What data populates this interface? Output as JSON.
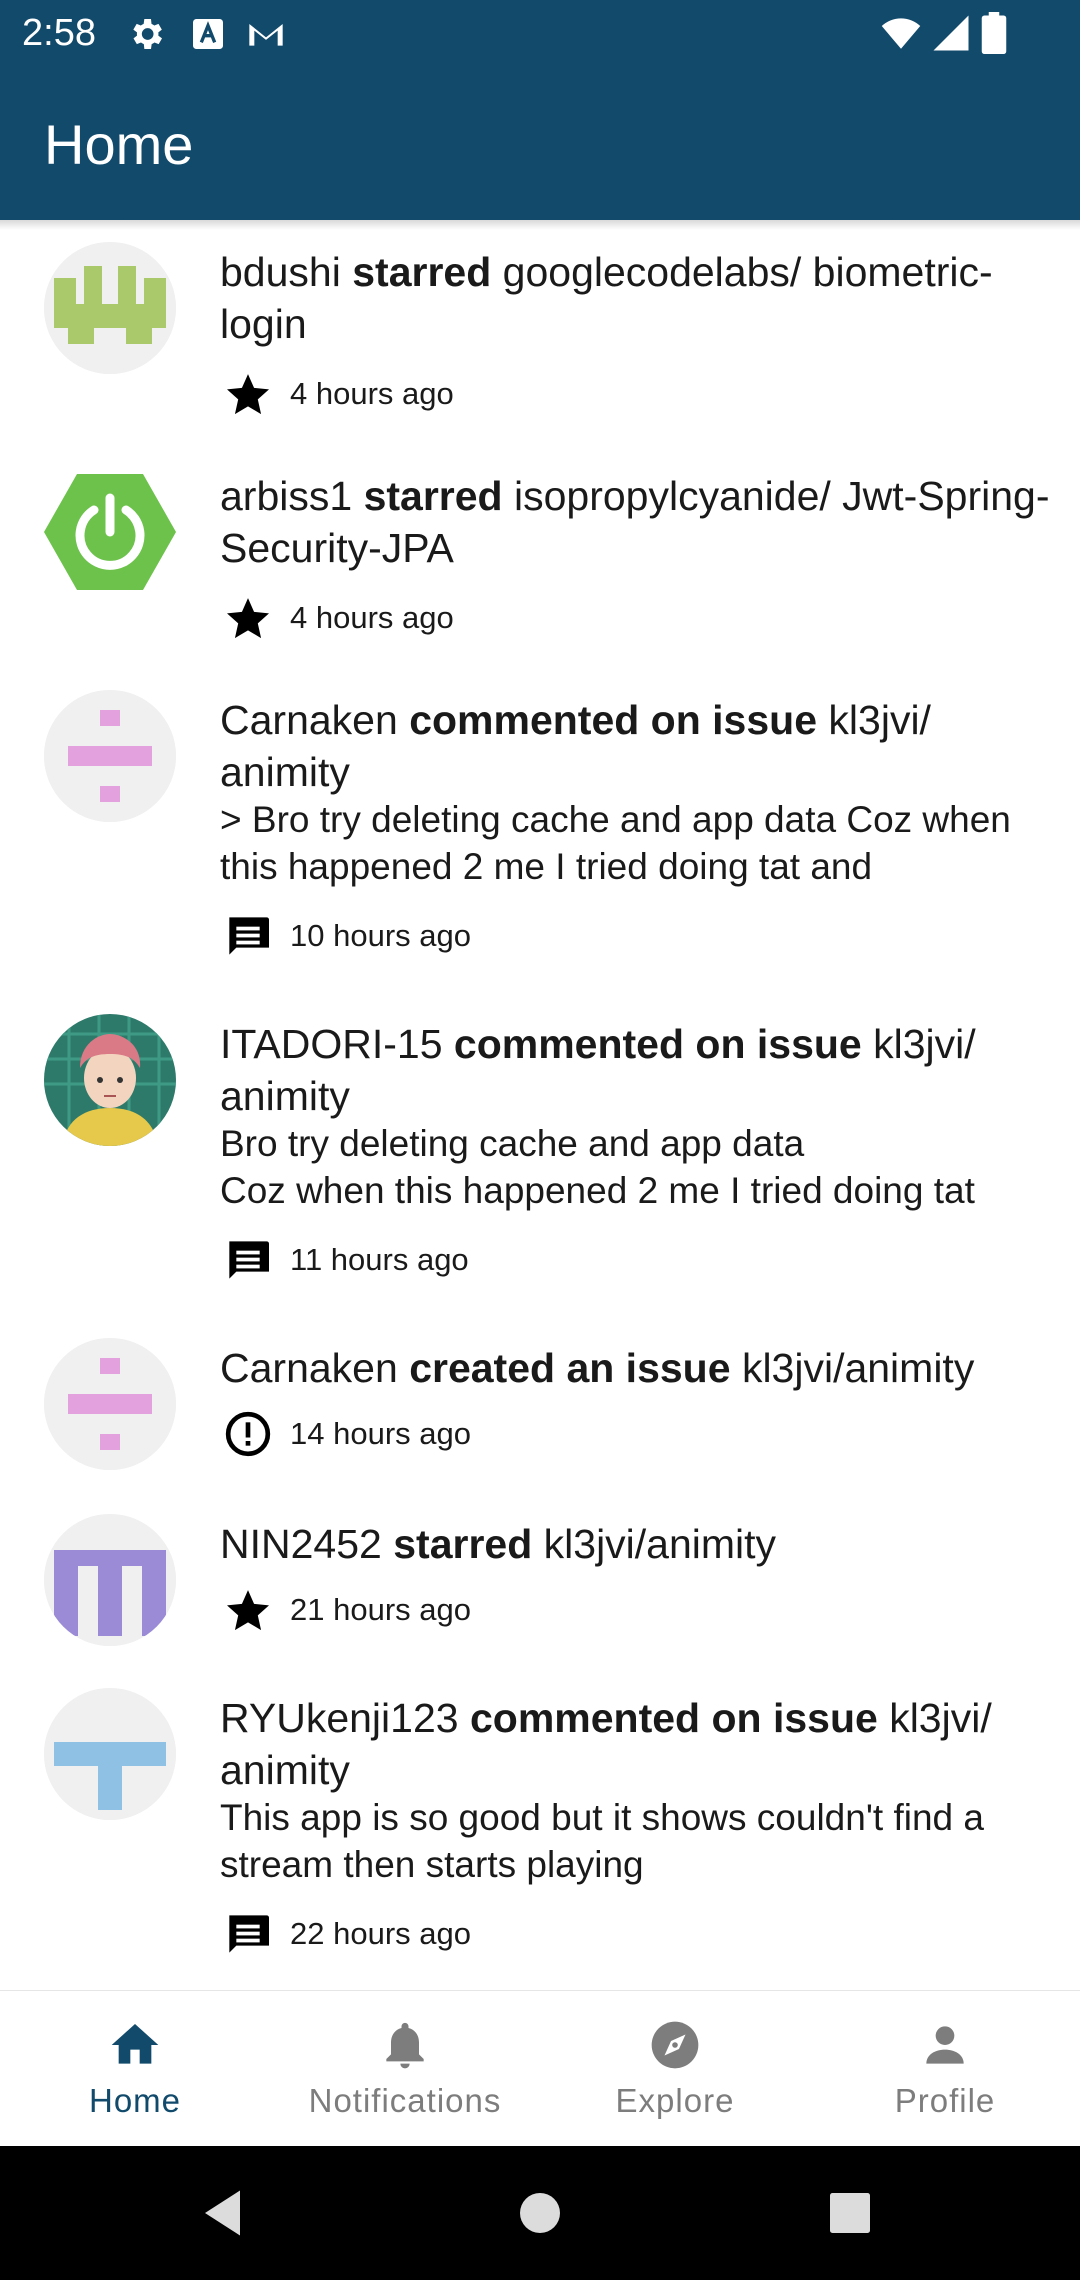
{
  "status_bar": {
    "time": "2:58",
    "left_icons": [
      "gear-icon",
      "font-a-icon",
      "gmail-icon"
    ],
    "right_icons": [
      "wifi-icon",
      "cell-signal-icon",
      "battery-icon"
    ]
  },
  "app_bar": {
    "title": "Home"
  },
  "colors": {
    "primary": "#114a6b",
    "nav_inactive": "#7d7d7d"
  },
  "feed": [
    {
      "user": "bdushi",
      "action": "starred",
      "repo": "googlecodelabs/ biometric-login",
      "body": "",
      "meta_icon": "star-icon",
      "time": "4 hours ago"
    },
    {
      "user": "arbiss1",
      "action": "starred",
      "repo": "isopropylcyanide/ Jwt-Spring-Security-JPA",
      "body": "",
      "meta_icon": "star-icon",
      "time": "4 hours ago"
    },
    {
      "user": "Carnaken",
      "action": "commented on issue",
      "repo": "kl3jvi/ animity",
      "body": "> Bro try deleting cache and app data Coz when this happened 2 me I tried doing tat and",
      "meta_icon": "comment-icon",
      "time": "10 hours ago"
    },
    {
      "user": "ITADORI-15",
      "action": "commented on issue",
      "repo": "kl3jvi/ animity",
      "body": "Bro try deleting cache and app data\nCoz when this happened 2 me I tried doing tat",
      "meta_icon": "comment-icon",
      "time": "11 hours ago"
    },
    {
      "user": "Carnaken",
      "action": "created an issue",
      "repo": "kl3jvi/animity",
      "body": "",
      "meta_icon": "issue-icon",
      "time": "14 hours ago"
    },
    {
      "user": "NIN2452",
      "action": "starred",
      "repo": "kl3jvi/animity",
      "body": "",
      "meta_icon": "star-icon",
      "time": "21 hours ago"
    },
    {
      "user": "RYUkenji123",
      "action": "commented on issue",
      "repo": "kl3jvi/ animity",
      "body": "This app is so good but it shows couldn't find a stream then starts playing",
      "meta_icon": "comment-icon",
      "time": "22 hours ago"
    }
  ],
  "bottom_nav": {
    "items": [
      {
        "label": "Home",
        "icon": "home-icon",
        "active": true
      },
      {
        "label": "Notifications",
        "icon": "bell-icon",
        "active": false
      },
      {
        "label": "Explore",
        "icon": "compass-icon",
        "active": false
      },
      {
        "label": "Profile",
        "icon": "person-icon",
        "active": false
      }
    ]
  },
  "system_nav": [
    "back-icon",
    "home-circle-icon",
    "recents-icon"
  ]
}
